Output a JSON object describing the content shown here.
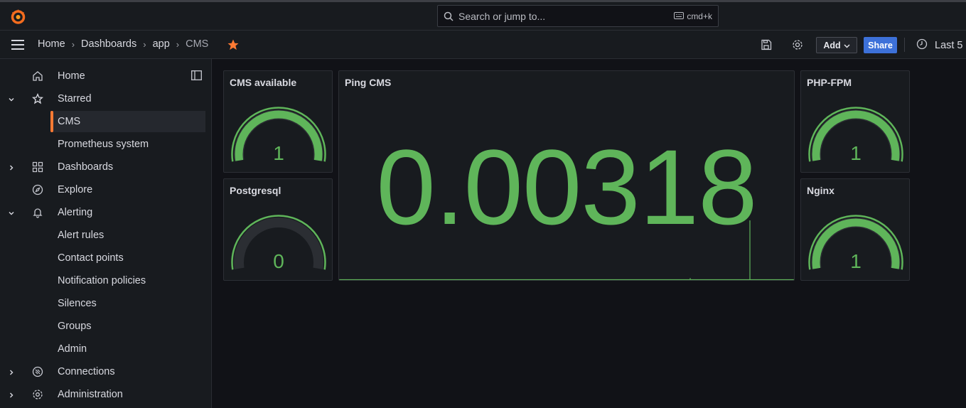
{
  "topbar": {
    "search_placeholder": "Search or jump to...",
    "shortcut": "cmd+k"
  },
  "breadcrumb": {
    "items": [
      "Home",
      "Dashboards",
      "app",
      "CMS"
    ]
  },
  "toolbar": {
    "add_label": "Add",
    "share_label": "Share",
    "time_range_label": "Last 5"
  },
  "sidebar": {
    "items": [
      {
        "label": "Home",
        "icon": "home-icon"
      },
      {
        "label": "Starred",
        "icon": "star-icon",
        "expanded": true
      },
      {
        "label": "CMS",
        "active": true
      },
      {
        "label": "Prometheus system"
      },
      {
        "label": "Dashboards",
        "icon": "dashboards-icon",
        "expanded": false
      },
      {
        "label": "Explore",
        "icon": "compass-icon"
      },
      {
        "label": "Alerting",
        "icon": "bell-icon",
        "expanded": true
      },
      {
        "label": "Alert rules"
      },
      {
        "label": "Contact points"
      },
      {
        "label": "Notification policies"
      },
      {
        "label": "Silences"
      },
      {
        "label": "Groups"
      },
      {
        "label": "Admin"
      },
      {
        "label": "Connections",
        "icon": "connections-icon",
        "expanded": false
      },
      {
        "label": "Administration",
        "icon": "gear-icon",
        "expanded": false
      }
    ]
  },
  "panels": {
    "cms_available": {
      "title": "CMS available",
      "value": "1",
      "fraction": 1.0
    },
    "postgresql": {
      "title": "Postgresql",
      "value": "0",
      "fraction": 0.0
    },
    "ping_cms": {
      "title": "Ping CMS",
      "value": "0.00318"
    },
    "php_fpm": {
      "title": "PHP-FPM",
      "value": "1",
      "fraction": 1.0
    },
    "nginx": {
      "title": "Nginx",
      "value": "1",
      "fraction": 1.0
    }
  },
  "colors": {
    "accent_orange": "#ff7a33",
    "gauge_green": "#5fb55a",
    "gauge_track": "#2b2e33",
    "share_blue": "#3d71d9",
    "background": "#111217",
    "panel_bg": "#181b1f"
  }
}
